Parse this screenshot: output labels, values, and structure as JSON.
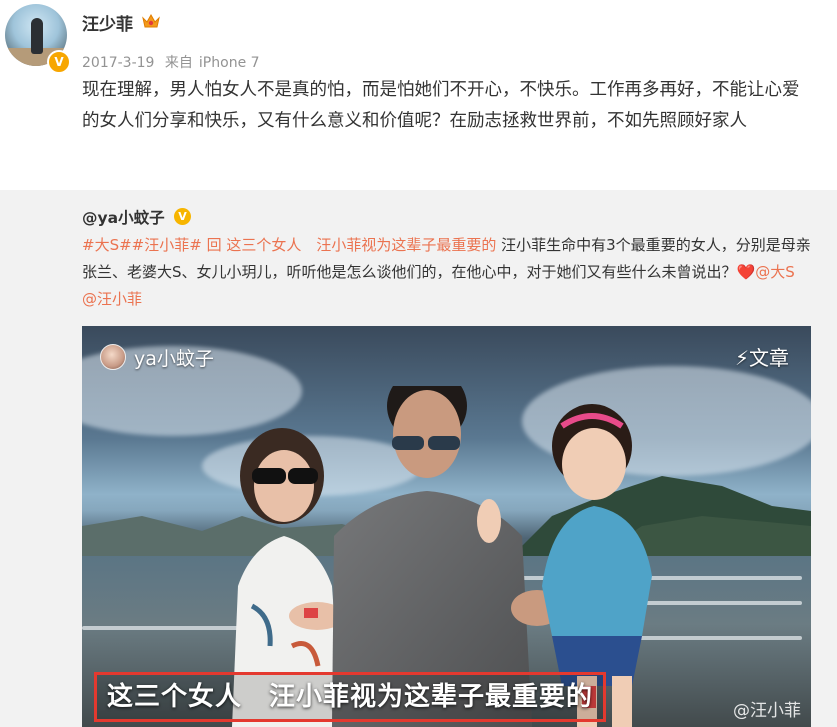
{
  "post": {
    "author": "汪少菲",
    "avatar_badge": "V",
    "date": "2017-3-19",
    "source_prefix": "来自",
    "source": "iPhone 7",
    "text": "现在理解，男人怕女人不是真的怕，而是怕她们不开心，不快乐。工作再多再好，不能让心爱的女人们分享和快乐，又有什么意义和价值呢？在励志拯救世界前，不如先照顾好家人"
  },
  "repost": {
    "author": "@ya小蚊子",
    "badge": "V",
    "topic1": "#大S#",
    "topic2": "#汪小菲#",
    "article_link": "回 这三个女人　汪小菲视为这辈子最重要的",
    "text_main": " 汪小菲生命中有3个最重要的女人，分别是母亲张兰、老婆大S、女儿小玥儿，听听他是怎么谈他们的，在他心中，对于她们又有些什么未曾说出？",
    "heart": "❤️",
    "mention1": "@大S",
    "mention2": "@汪小菲",
    "media": {
      "channel": "ya小蚊子",
      "type_label": "⚡文章",
      "caption": "这三个女人　汪小菲视为这辈子最重要的",
      "watermark": "@汪小菲"
    }
  },
  "colors": {
    "link": "#eb7350",
    "caption_border": "#e4392f",
    "verify_badge": "#f7a600"
  }
}
